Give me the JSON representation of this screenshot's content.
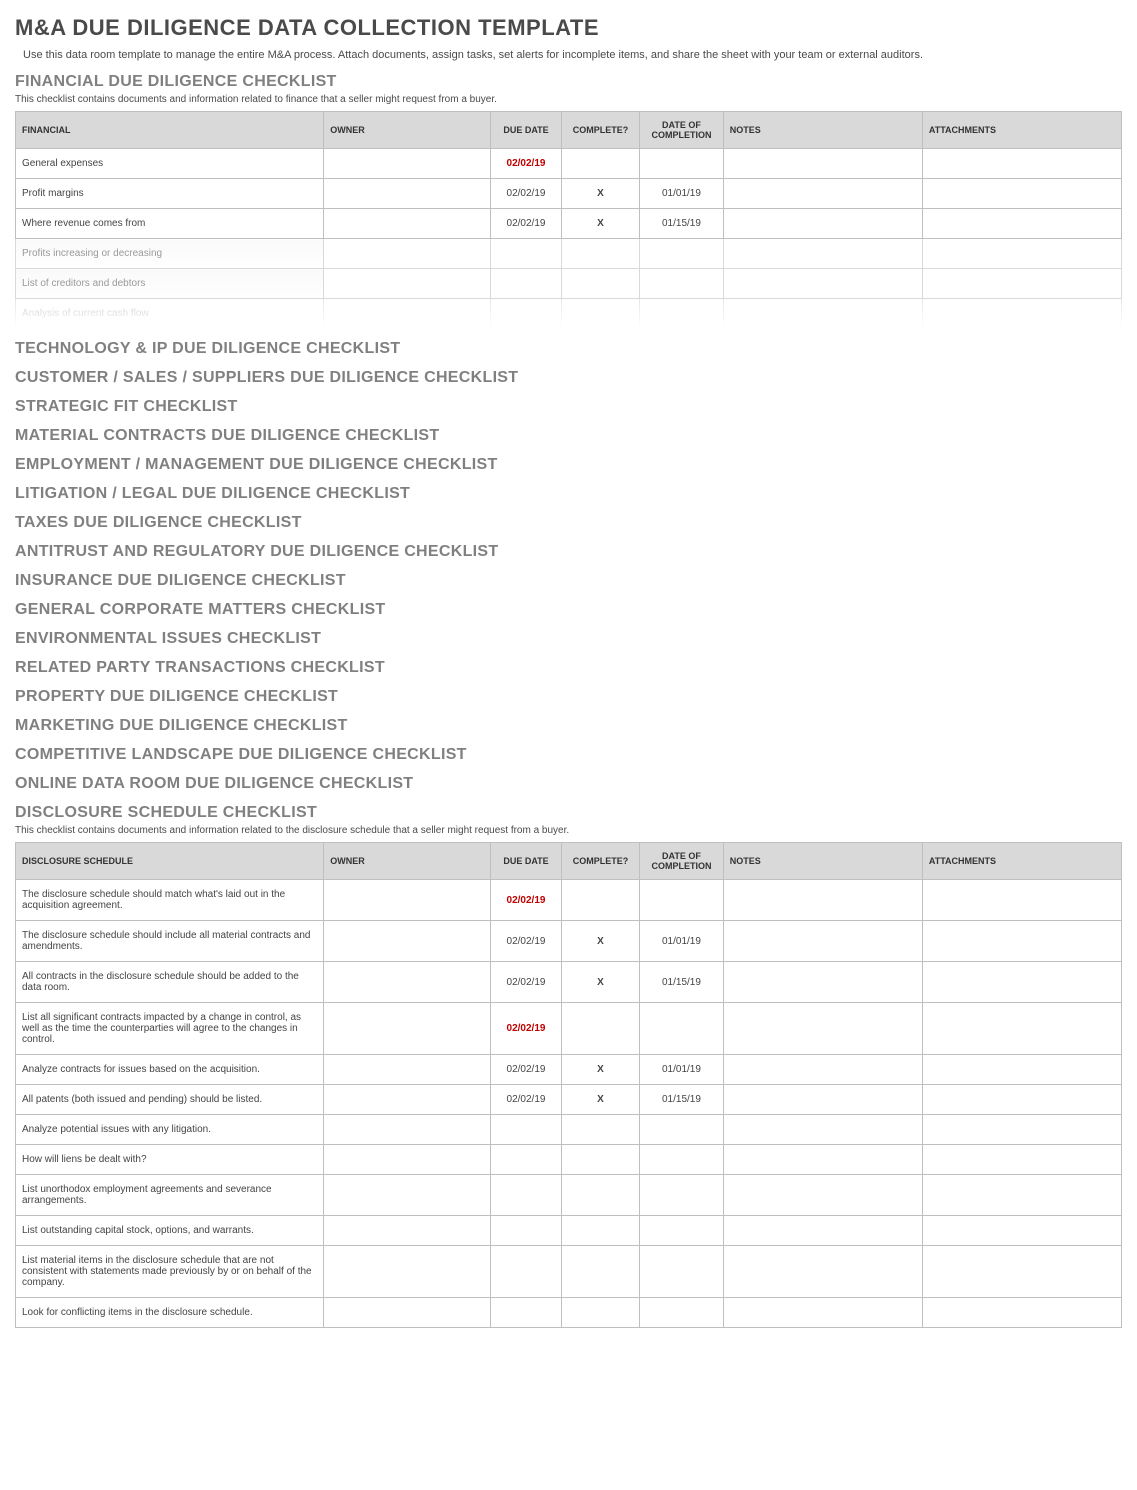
{
  "header": {
    "title": "M&A DUE DILIGENCE DATA COLLECTION TEMPLATE",
    "subtitle": "Use this data room template to manage the entire M&A process. Attach documents, assign tasks, set alerts for incomplete items, and share the sheet with your team or external auditors."
  },
  "financial": {
    "title": "FINANCIAL DUE DILIGENCE CHECKLIST",
    "desc": "This checklist contains documents and information related to finance that a seller might request from a buyer.",
    "columns": {
      "item": "FINANCIAL",
      "owner": "OWNER",
      "due": "DUE DATE",
      "complete": "COMPLETE?",
      "doc": "DATE OF COMPLETION",
      "notes": "NOTES",
      "attach": "ATTACHMENTS"
    },
    "rows": [
      {
        "item": "General expenses",
        "due": "02/02/19",
        "due_red": true,
        "complete": "",
        "doc": ""
      },
      {
        "item": "Profit margins",
        "due": "02/02/19",
        "due_red": false,
        "complete": "X",
        "doc": "01/01/19"
      },
      {
        "item": "Where revenue comes from",
        "due": "02/02/19",
        "due_red": false,
        "complete": "X",
        "doc": "01/15/19"
      },
      {
        "item": "Profits increasing or decreasing",
        "due": "",
        "due_red": false,
        "complete": "",
        "doc": "",
        "faded": "faded"
      },
      {
        "item": "List of creditors and debtors",
        "due": "",
        "due_red": false,
        "complete": "",
        "doc": "",
        "faded": "faded"
      },
      {
        "item": "Analysis of current cash flow",
        "due": "",
        "due_red": false,
        "complete": "",
        "doc": "",
        "faded": "faded2"
      }
    ]
  },
  "checklists": [
    "TECHNOLOGY & IP DUE DILIGENCE CHECKLIST",
    "CUSTOMER / SALES / SUPPLIERS DUE DILIGENCE CHECKLIST",
    "STRATEGIC FIT CHECKLIST",
    "MATERIAL CONTRACTS DUE DILIGENCE CHECKLIST",
    "EMPLOYMENT / MANAGEMENT DUE DILIGENCE CHECKLIST",
    "LITIGATION / LEGAL DUE DILIGENCE CHECKLIST",
    "TAXES DUE DILIGENCE CHECKLIST",
    "ANTITRUST AND REGULATORY DUE DILIGENCE CHECKLIST",
    "INSURANCE DUE DILIGENCE CHECKLIST",
    "GENERAL CORPORATE MATTERS CHECKLIST",
    "ENVIRONMENTAL ISSUES CHECKLIST",
    "RELATED PARTY TRANSACTIONS CHECKLIST",
    "PROPERTY DUE DILIGENCE CHECKLIST",
    "MARKETING DUE DILIGENCE CHECKLIST",
    "COMPETITIVE LANDSCAPE DUE DILIGENCE CHECKLIST",
    "ONLINE DATA ROOM DUE DILIGENCE CHECKLIST"
  ],
  "disclosure": {
    "title": "DISCLOSURE SCHEDULE CHECKLIST",
    "desc": "This checklist contains documents and information related to the disclosure schedule that a seller might request from a buyer.",
    "columns": {
      "item": "DISCLOSURE SCHEDULE",
      "owner": "OWNER",
      "due": "DUE DATE",
      "complete": "COMPLETE?",
      "doc": "DATE OF COMPLETION",
      "notes": "NOTES",
      "attach": "ATTACHMENTS"
    },
    "rows": [
      {
        "item": "The disclosure schedule should match what's laid out in the acquisition agreement.",
        "due": "02/02/19",
        "due_red": true,
        "complete": "",
        "doc": ""
      },
      {
        "item": "The disclosure schedule should include all material contracts and amendments.",
        "due": "02/02/19",
        "due_red": false,
        "complete": "X",
        "doc": "01/01/19"
      },
      {
        "item": "All contracts in the disclosure schedule should be added to the data room.",
        "due": "02/02/19",
        "due_red": false,
        "complete": "X",
        "doc": "01/15/19"
      },
      {
        "item": "List all significant contracts impacted by a change in control, as well as the time the counterparties will agree to the changes in control.",
        "due": "02/02/19",
        "due_red": true,
        "complete": "",
        "doc": ""
      },
      {
        "item": "Analyze contracts for issues based on the acquisition.",
        "due": "02/02/19",
        "due_red": false,
        "complete": "X",
        "doc": "01/01/19"
      },
      {
        "item": "All patents (both issued and pending) should be listed.",
        "due": "02/02/19",
        "due_red": false,
        "complete": "X",
        "doc": "01/15/19"
      },
      {
        "item": "Analyze potential issues with any litigation.",
        "due": "",
        "due_red": false,
        "complete": "",
        "doc": ""
      },
      {
        "item": "How will liens be dealt with?",
        "due": "",
        "due_red": false,
        "complete": "",
        "doc": ""
      },
      {
        "item": "List unorthodox employment agreements and severance arrangements.",
        "due": "",
        "due_red": false,
        "complete": "",
        "doc": ""
      },
      {
        "item": "List outstanding capital stock, options, and warrants.",
        "due": "",
        "due_red": false,
        "complete": "",
        "doc": ""
      },
      {
        "item": "List material items in the disclosure schedule that are not consistent with statements made previously by or on behalf of the company.",
        "due": "",
        "due_red": false,
        "complete": "",
        "doc": ""
      },
      {
        "item": "Look for conflicting items in the disclosure schedule.",
        "due": "",
        "due_red": false,
        "complete": "",
        "doc": ""
      }
    ]
  }
}
